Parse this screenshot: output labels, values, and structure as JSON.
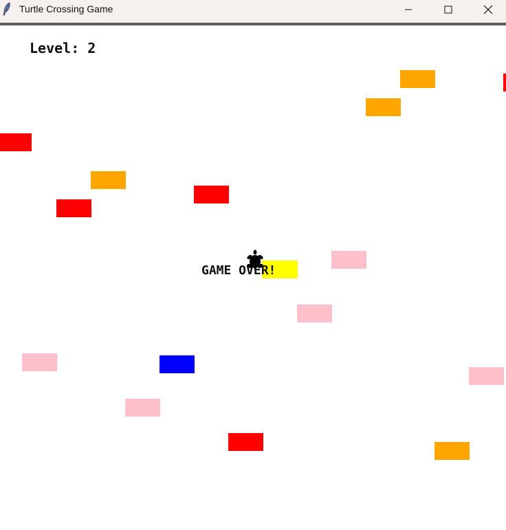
{
  "window": {
    "title": "Turtle Crossing Game",
    "controls": [
      "minimize-icon",
      "maximize-icon",
      "close-icon"
    ]
  },
  "game": {
    "level_text": "Level: 2",
    "level": 2,
    "status_text": "GAME OVER!",
    "player": "turtle-icon",
    "colors": {
      "red": "#ff0000",
      "orange": "#ffa500",
      "pink": "#ffc0cb",
      "blue": "#0000ff",
      "yellow": "#ffff00"
    },
    "cars": [
      {
        "color": "#ffa500"
      },
      {
        "color": "#ffa500"
      },
      {
        "color": "#ff0000"
      },
      {
        "color": "#ffa500"
      },
      {
        "color": "#ff0000"
      },
      {
        "color": "#ff0000"
      },
      {
        "color": "#ffc0cb"
      },
      {
        "color": "#ffff00"
      },
      {
        "color": "#ffc0cb"
      },
      {
        "color": "#ffc0cb"
      },
      {
        "color": "#0000ff"
      },
      {
        "color": "#ffc0cb"
      },
      {
        "color": "#ffc0cb"
      },
      {
        "color": "#ff0000"
      },
      {
        "color": "#ffa500"
      },
      {
        "color": "#ff0000"
      }
    ]
  }
}
